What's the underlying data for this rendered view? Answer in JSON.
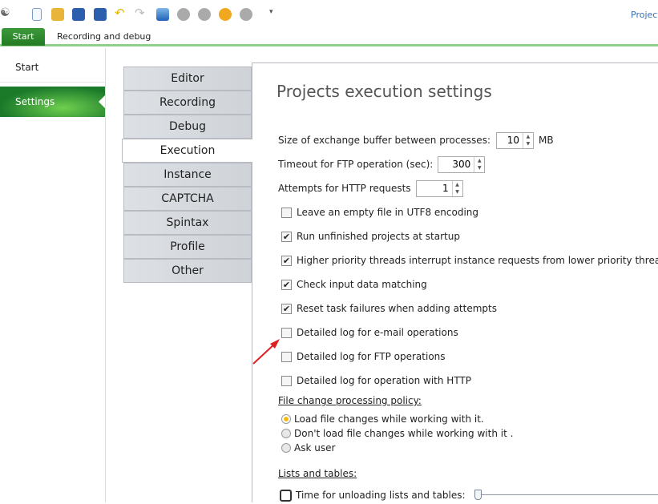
{
  "toolbar": {
    "icons": [
      "users-icon",
      "new-file-icon",
      "open-folder-icon",
      "save-icon",
      "save-all-icon",
      "undo-icon",
      "redo-icon",
      "book-icon",
      "debug-play-icon",
      "play-icon",
      "refresh-icon",
      "stop-icon",
      "overflow-icon"
    ],
    "right_label": "Project"
  },
  "ribbon": {
    "tabs": [
      "Start",
      "Recording and debug"
    ]
  },
  "sidebar": {
    "items": [
      "Start",
      "Settings"
    ]
  },
  "tabs": [
    "Editor",
    "Recording",
    "Debug",
    "Execution",
    "Instance",
    "CAPTCHA",
    "Spintax",
    "Profile",
    "Other"
  ],
  "content": {
    "title": "Projects execution settings",
    "buffer_label": "Size of exchange buffer between processes:",
    "buffer_value": "10",
    "buffer_unit": "MB",
    "ftp_label": "Timeout for FTP operation (sec):",
    "ftp_value": "300",
    "http_label": "Attempts for HTTP requests",
    "http_value": "1",
    "checkboxes": [
      {
        "label": "Leave an empty file in UTF8 encoding",
        "checked": false
      },
      {
        "label": "Run unfinished projects at startup",
        "checked": true
      },
      {
        "label": "Higher priority threads interrupt instance requests from lower priority threads",
        "checked": true
      },
      {
        "label": "Check input data matching",
        "checked": true
      },
      {
        "label": "Reset task failures when adding attempts",
        "checked": true
      },
      {
        "label": "Detailed log for e-mail operations",
        "checked": false
      },
      {
        "label": "Detailed log for FTP operations",
        "checked": false
      },
      {
        "label": "Detailed log for operation with HTTP",
        "checked": false
      }
    ],
    "policy_title": "File change processing policy:",
    "policy_options": [
      "Load file changes while working with it.",
      "Don't load file changes while working with it .",
      "Ask user"
    ],
    "policy_selected": 0,
    "lists_title": "Lists and tables:",
    "unload_label": "Time for unloading lists and tables:",
    "unload_slider": 0
  },
  "annotation_color": "#e02020"
}
